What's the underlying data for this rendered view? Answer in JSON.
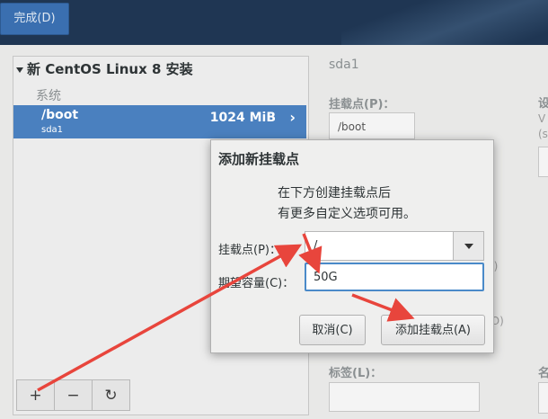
{
  "header": {
    "done_label": "完成(D)"
  },
  "left": {
    "install_title": "新 CentOS Linux 8 安装",
    "section": "系统",
    "mounts": [
      {
        "path": "/boot",
        "device": "sda1",
        "size": "1024 MiB"
      }
    ],
    "toolbar": {
      "add": "+",
      "remove": "−",
      "refresh": "↻"
    }
  },
  "right": {
    "device": "sda1",
    "mount_label": "挂载点(P)：",
    "mount_value": "/boot",
    "settings_label": "设",
    "extra1": "V",
    "extra2": "(s",
    "frag_e": "E)",
    "frag_o": "(O)",
    "tag_label": "标签(L)：",
    "name_label": "名"
  },
  "dialog": {
    "title": "添加新挂载点",
    "desc_line1": "在下方创建挂载点后",
    "desc_line2": "有更多自定义选项可用。",
    "mount_label": "挂载点(P)：",
    "mount_value": "/",
    "capacity_label": "期望容量(C)：",
    "capacity_value": "50G",
    "cancel_label": "取消(C)",
    "add_label": "添加挂载点(A)"
  },
  "colors": {
    "annotation_arrow": "#e8453c",
    "selected_row": "#4a80bf",
    "focus": "#4a8ac9"
  }
}
